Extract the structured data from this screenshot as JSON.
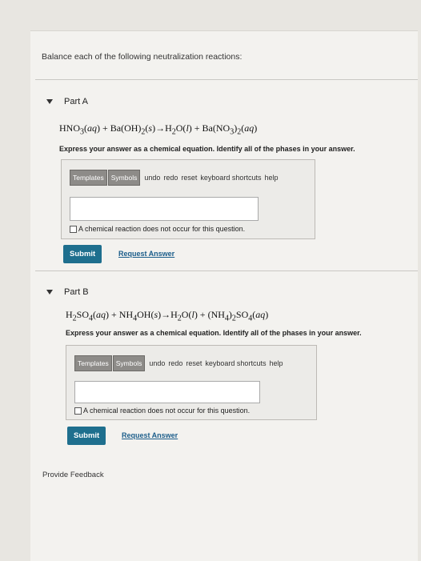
{
  "intro": "Balance each of the following neutralization reactions:",
  "parts": [
    {
      "title": "Part A",
      "instruction": "Express your answer as a chemical equation. Identify all of the phases in your answer.",
      "toolbar": [
        "Templates",
        "Symbols",
        "undo",
        "redo",
        "reset",
        "keyboard shortcuts",
        "help"
      ],
      "no_reaction": "A chemical reaction does not occur for this question.",
      "submit": "Submit",
      "request": "Request Answer"
    },
    {
      "title": "Part B",
      "instruction": "Express your answer as a chemical equation. Identify all of the phases in your answer.",
      "toolbar": [
        "Templates",
        "Symbols",
        "undo",
        "redo",
        "reset",
        "keyboard shortcuts",
        "help"
      ],
      "no_reaction": "A chemical reaction does not occur for this question.",
      "submit": "Submit",
      "request": "Request Answer"
    }
  ],
  "feedback": "Provide Feedback"
}
